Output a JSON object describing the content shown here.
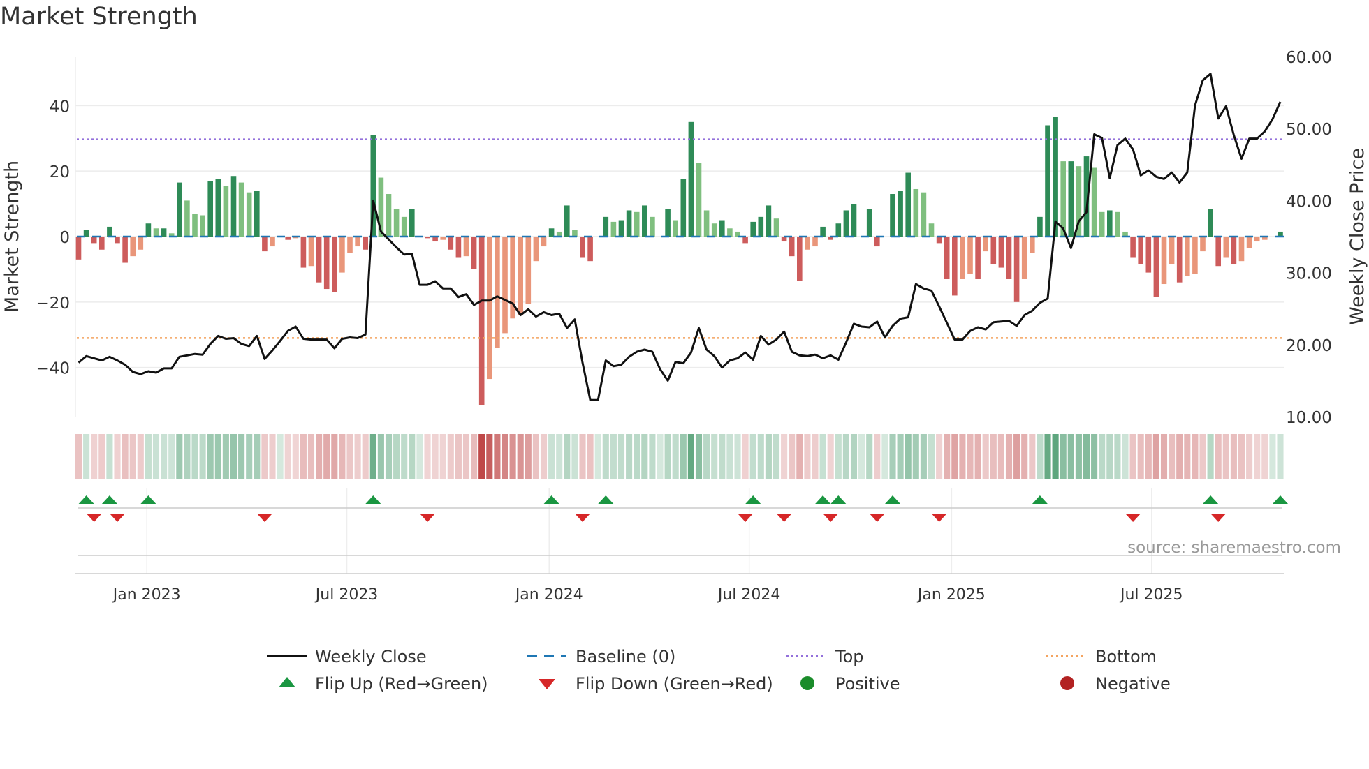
{
  "chart_data": {
    "type": "bar",
    "title": "Market Strength",
    "ylabel": "Market Strength",
    "y2label": "Weekly Close Price",
    "ylim": [
      -55,
      55
    ],
    "y2lim": [
      10,
      60
    ],
    "yticks": [
      -40,
      -20,
      0,
      20,
      40
    ],
    "y2ticks": [
      "10.00",
      "20.00",
      "30.00",
      "40.00",
      "50.00",
      "60.00"
    ],
    "top_level": 29.7,
    "bottom_level": -31,
    "xticks": [
      {
        "label": "Jan 2023",
        "week": 8.8
      },
      {
        "label": "Jul 2023",
        "week": 34.6
      },
      {
        "label": "Jan 2024",
        "week": 60.7
      },
      {
        "label": "Jul 2024",
        "week": 86.5
      },
      {
        "label": "Jan 2025",
        "week": 112.6
      },
      {
        "label": "Jul 2025",
        "week": 138.4
      }
    ],
    "strength": [
      -7,
      2,
      -2,
      -4,
      3,
      -2,
      -8,
      -6,
      -4,
      4,
      2.5,
      2.5,
      1,
      16.5,
      11,
      7,
      6.5,
      17,
      17.5,
      15.5,
      18.5,
      16.5,
      13.5,
      14,
      -4.5,
      -3,
      0,
      -1,
      -0.5,
      -9.5,
      -9,
      -14,
      -16,
      -17,
      -11,
      -5,
      -3,
      -4,
      31,
      18,
      13,
      8.5,
      6,
      8.5,
      0,
      -0.5,
      -1.5,
      -1,
      -4,
      -6.5,
      -6,
      -10,
      -51.5,
      -43.5,
      -34,
      -29.5,
      -25,
      -24,
      -20.5,
      -7.5,
      -3,
      2.5,
      1.5,
      9.5,
      2,
      -6.5,
      -7.5,
      0,
      6,
      4.5,
      5,
      8,
      7.5,
      9.5,
      6,
      0,
      8.5,
      5,
      17.5,
      35,
      22.5,
      8,
      4,
      5,
      2.5,
      1.5,
      -2,
      4.5,
      6,
      9.5,
      5.5,
      -1.5,
      -6,
      -13.5,
      -4,
      -3,
      3,
      -1,
      4,
      8,
      10,
      0,
      8.5,
      -3,
      0,
      13,
      14,
      19.5,
      14.5,
      13.5,
      4,
      -2,
      -13,
      -18,
      -13,
      -11.5,
      -13,
      -4.5,
      -8.5,
      -9.5,
      -13,
      -20,
      -13,
      -5,
      6,
      34,
      36.5,
      23,
      23,
      21.5,
      24.5,
      21,
      7.5,
      8,
      7.5,
      1.5,
      -6.5,
      -8.5,
      -11,
      -18.5,
      -14.5,
      -8.5,
      -14,
      -12,
      -11.5,
      -4.5,
      8.5,
      -9,
      -6.5,
      -8.5,
      -7.5,
      -3.5,
      -1.5,
      -1,
      0,
      1.5
    ],
    "weekly_close": [
      17.5,
      18.4,
      18.1,
      17.8,
      18.3,
      17.8,
      17.2,
      16.2,
      15.9,
      16.3,
      16.1,
      16.7,
      16.7,
      18.3,
      18.5,
      18.7,
      18.6,
      20.1,
      21.2,
      20.8,
      20.9,
      20.1,
      19.8,
      21.2,
      18,
      19.2,
      20.5,
      21.9,
      22.5,
      20.8,
      20.7,
      20.7,
      20.7,
      19.5,
      20.8,
      21,
      20.9,
      21.4,
      40,
      35.7,
      34.6,
      33.5,
      32.5,
      32.6,
      28.3,
      28.3,
      28.8,
      27.8,
      27.8,
      26.6,
      27,
      25.5,
      26.1,
      26.1,
      26.7,
      26.2,
      25.7,
      24.1,
      24.9,
      23.9,
      24.5,
      24.1,
      24.3,
      22.3,
      23.5,
      17.5,
      12.3,
      12.3,
      17.8,
      17,
      17.2,
      18.3,
      19,
      19.3,
      19,
      16.6,
      15,
      17.6,
      17.4,
      18.9,
      22.3,
      19.3,
      18.4,
      16.8,
      17.8,
      18.1,
      18.9,
      17.9,
      21.2,
      20,
      20.7,
      21.8,
      19,
      18.5,
      18.4,
      18.6,
      18.1,
      18.5,
      17.9,
      20.3,
      22.9,
      22.5,
      22.4,
      23.2,
      21,
      22.6,
      23.6,
      23.8,
      28.4,
      27.8,
      27.5,
      25.3,
      23,
      20.7,
      20.7,
      21.9,
      22.4,
      22.1,
      23.1,
      23.2,
      23.3,
      22.6,
      24.1,
      24.7,
      25.8,
      26.4,
      37.1,
      36.1,
      33.4,
      37.1,
      38.4,
      49.2,
      48.7,
      43.1,
      47.7,
      48.6,
      47.1,
      43.5,
      44.2,
      43.3,
      43,
      43.9,
      42.5,
      43.9,
      53.2,
      56.7,
      57.6,
      51.4,
      53.1,
      49.1,
      45.8,
      48.6,
      48.6,
      49.6,
      51.3,
      53.7
    ],
    "legend": {
      "weekly_close": "Weekly Close",
      "baseline": "Baseline (0)",
      "top": "Top",
      "bottom": "Bottom",
      "flip_up": "Flip Up (Red→Green)",
      "flip_down": "Flip Down (Green→Red)",
      "positive": "Positive",
      "negative": "Negative"
    },
    "legend_position": "bottom",
    "colors": {
      "pos_strong": "#2e8b57",
      "pos_weak": "#7fbf7f",
      "neg_strong": "#cd5c5c",
      "neg_weak": "#e9967a",
      "baseline": "#1f77b4",
      "top": "#9370db",
      "bottom": "#f4a460",
      "flip_up": "#1a9641",
      "flip_down": "#d62728",
      "positive": "#1a8c2a",
      "negative": "#b22222",
      "close": "#111111"
    }
  },
  "source": "source: sharemaestro.com"
}
